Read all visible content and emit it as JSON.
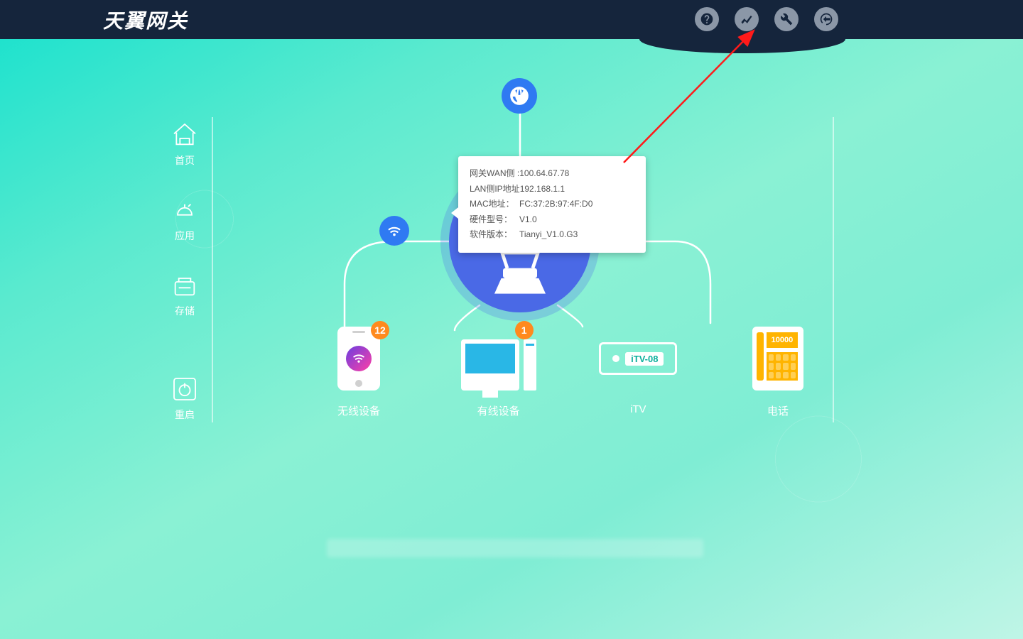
{
  "header": {
    "logo_text": "天翼网关"
  },
  "sidebar": {
    "items": [
      {
        "label": "首页"
      },
      {
        "label": "应用"
      },
      {
        "label": "存储"
      },
      {
        "label": "重启"
      }
    ]
  },
  "devices": {
    "wireless": {
      "label": "无线设备",
      "badge": "12"
    },
    "wired": {
      "label": "有线设备",
      "badge": "1"
    },
    "itv": {
      "label": "iTV",
      "model": "iTV-08"
    },
    "phone": {
      "label": "电话",
      "display": "10000"
    }
  },
  "tooltip": {
    "rows": [
      {
        "k": "网关WAN侧 :",
        "v": "100.64.67.78"
      },
      {
        "k": "LAN侧IP地址",
        "v": "192.168.1.1"
      },
      {
        "k": "MAC地址：",
        "v": "FC:37:2B:97:4F:D0"
      },
      {
        "k": "硬件型号：",
        "v": "V1.0"
      },
      {
        "k": "软件版本：",
        "v": "Tianyi_V1.0.G3"
      }
    ]
  }
}
